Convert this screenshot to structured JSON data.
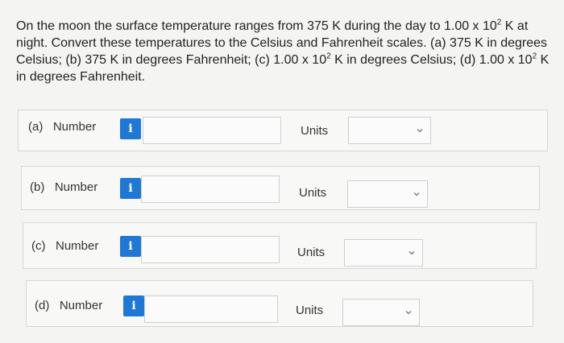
{
  "question": {
    "line1_a": "On the moon the surface temperature ranges from 375 K during the day to 1.00 x 10",
    "line1_exp": "2",
    "line1_b": " K at",
    "line2": "night. Convert these temperatures to the Celsius and Fahrenheit scales. (a) 375 K in degrees",
    "line3_a": "Celsius; (b) 375 K in degrees Fahrenheit; (c) 1.00 x 10",
    "line3_exp1": "2",
    "line3_b": " K in degrees Celsius; (d) 1.00 x 10",
    "line3_exp2": "2",
    "line3_c": " K",
    "line4": "in degrees Fahrenheit."
  },
  "rows": [
    {
      "label": "(a)   Number",
      "info": "i",
      "value": "",
      "units_label": "Units",
      "units_value": ""
    },
    {
      "label": "(b)   Number",
      "info": "i",
      "value": "",
      "units_label": "Units",
      "units_value": ""
    },
    {
      "label": "(c)   Number",
      "info": "i",
      "value": "",
      "units_label": "Units",
      "units_value": ""
    },
    {
      "label": "(d)   Number",
      "info": "i",
      "value": "",
      "units_label": "Units",
      "units_value": ""
    }
  ],
  "colors": {
    "info_button": "#1f78d6",
    "background": "#f4f4f2"
  },
  "icons": {
    "info": "info-icon",
    "dropdown": "chevron-down-icon"
  }
}
